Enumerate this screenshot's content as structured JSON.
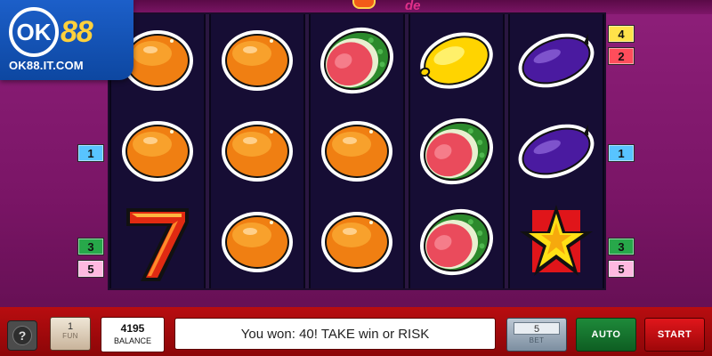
{
  "brand": {
    "mark": "OK",
    "digits": "88",
    "url": "OK88.IT.COM"
  },
  "header_fragment": {
    "text": "de"
  },
  "reels": [
    [
      "orange",
      "orange",
      "seven"
    ],
    [
      "orange",
      "orange",
      "orange"
    ],
    [
      "watermelon",
      "orange",
      "orange"
    ],
    [
      "lemon",
      "watermelon",
      "watermelon"
    ],
    [
      "plum",
      "plum",
      "star"
    ]
  ],
  "lines_left": [
    {
      "label": "1",
      "color": "blue"
    },
    {
      "label": "3",
      "color": "green"
    },
    {
      "label": "5",
      "color": "pink"
    }
  ],
  "lines_right": [
    {
      "label": "4",
      "color": "yellow"
    },
    {
      "label": "2",
      "color": "red"
    },
    {
      "label": "1",
      "color": "blue"
    },
    {
      "label": "3",
      "color": "green"
    },
    {
      "label": "5",
      "color": "pink"
    }
  ],
  "panel": {
    "help_label": "?",
    "fun": {
      "value": "1",
      "label": "FUN"
    },
    "balance": {
      "value": "4195",
      "label": "BALANCE"
    },
    "message": "You won: 40! TAKE win or RISK",
    "bet": {
      "value": "5",
      "label": "BET"
    },
    "auto_label": "AUTO",
    "start_label": "START"
  },
  "colors": {
    "background": "#8e1f7a",
    "brand_blue": "#0d47a1",
    "brand_gold": "#ffd13c",
    "panel_red": "#b80d10",
    "auto_green": "#1e8a3a",
    "start_red": "#e0161b"
  }
}
